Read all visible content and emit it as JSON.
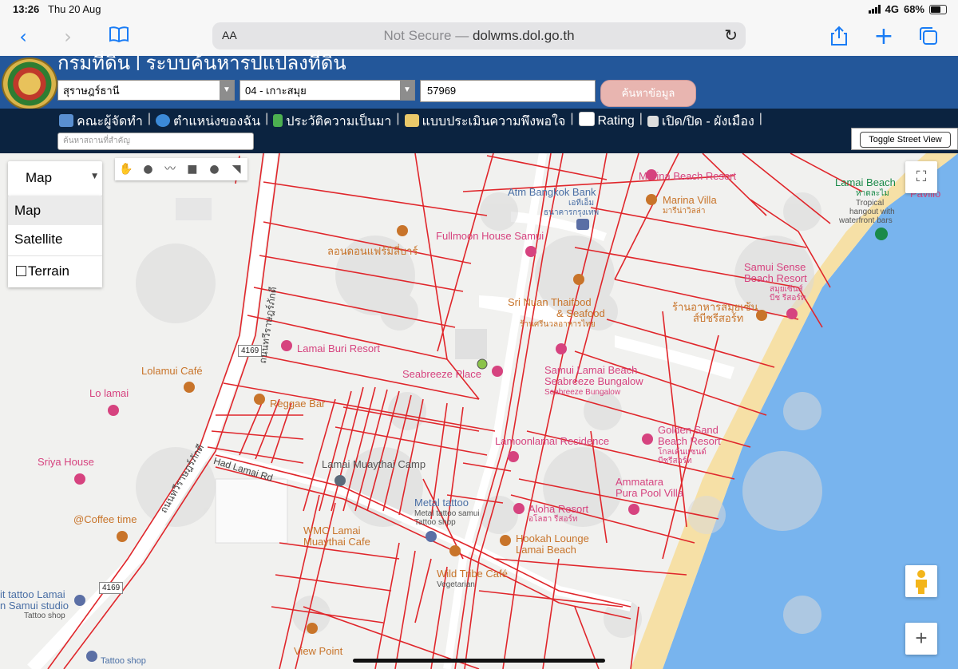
{
  "status_bar": {
    "time": "13:26",
    "date": "Thu 20 Aug",
    "network": "4G",
    "battery": "68%"
  },
  "browser": {
    "aa_label": "AA",
    "not_secure": "Not Secure —",
    "url": "dolwms.dol.go.th"
  },
  "header": {
    "title": "กรมที่ดิน | ระบบค้นหารูปแปลงที่ดิน",
    "province": "สุราษฎร์ธานี",
    "district": "04 - เกาะสมุย",
    "parcel_number": "57969",
    "search_button": "ค้นหาข้อมูล"
  },
  "nav": {
    "items": [
      "คณะผู้จัดทำ",
      "ตำแหน่งของฉัน",
      "ประวัติความเป็นมา",
      "แบบประเมินความพึงพอใจ",
      "Rating",
      "เปิด/ปิด - ผังเมือง"
    ],
    "place_placeholder": "ค้นหาสถานที่สำคัญ",
    "toggle_street_view": "Toggle Street View"
  },
  "map_controls": {
    "map_type": "Map",
    "menu": [
      "Map",
      "Satellite",
      "Terrain"
    ],
    "zoom_in": "+"
  },
  "map_labels": {
    "marina_beach": "Marina Beach Resort",
    "marina_villa": "Marina Villa",
    "marina_villa_th": "มารีน่าวิลล่า",
    "atm": "Atm Bangkok Bank",
    "atm_th1": "เอทีเอ็ม",
    "atm_th2": "ธนาคารกรุงเทพ",
    "lamai_beach": "Lamai Beach",
    "lamai_beach_th": "หาดละไม",
    "lamai_beach_desc1": "Tropical",
    "lamai_beach_desc2": "hangout with",
    "lamai_beach_desc3": "waterfront bars",
    "pavilio": "Pavilio",
    "fullmoon": "Fullmoon House Samui",
    "london": "ลอนดอนแฟร์มิลี่บาร์",
    "samui_sense1": "Samui Sense",
    "samui_sense2": "Beach Resort",
    "samui_sense_th1": "สมุยเซ้นส์",
    "samui_sense_th2": "บีช รีสอร์ท",
    "sri_nuan1": "Sri Nuan Thaifood",
    "sri_nuan2": "& Seafood",
    "sri_nuan_th": "ร้านศรีนวลอาหารไทย",
    "samui_sense_restaurant_th1": "ร้านอาหารสมุยเซ้น",
    "samui_sense_restaurant_th2": "ส์บีชรีสอร์ท",
    "road_4169_top": "4169",
    "lamai_buri": "Lamai Buri Resort",
    "seabreeze": "Seabreeze Place",
    "samui_lamai1": "Samui Lamai Beach",
    "samui_lamai2": "Seabreeze Bungalow",
    "samui_lamai3": "Seabreeze Bungalow",
    "lolamui": "Lolamui Café",
    "lo_lamai": "Lo lamai",
    "reggae": "Reggae Bar",
    "golden_sand1": "Golden Sand",
    "golden_sand2": "Beach Resort",
    "golden_sand_th1": "โกลเด้นแซนด์",
    "golden_sand_th2": "บีชรีสอร์ท",
    "lamoon": "Lamoonlamai Residence",
    "sriya": "Sriya House",
    "muaythai_camp": "Lamai Muaythai Camp",
    "had_lamai": "Had Lamai Rd",
    "ammatara1": "Ammatara",
    "ammatara2": "Pura Pool Villa",
    "metal_tattoo": "Metal tattoo",
    "metal_tattoo_sub1": "Metal tattoo samui",
    "metal_tattoo_sub2": "Tattoo shop",
    "aloha": "Aloha Resort",
    "aloha_th": "อโลฮา รีสอร์ท",
    "coffee_time": "@Coffee time",
    "wmc1": "WMC Lamai",
    "wmc2": "Muaythai Cafe",
    "hookah1": "Hookah Lounge",
    "hookah2": "Lamai Beach",
    "wild_tribe": "Wild Tribe Café",
    "wild_tribe_sub": "Vegetarian",
    "road_4169_bottom": "4169",
    "tattoo_lamai1": "it tattoo Lamai",
    "tattoo_lamai2": "n Samui studio",
    "tattoo_lamai3": "Tattoo shop",
    "tattoo_shop": "Tattoo shop",
    "view_point": "View Point",
    "road_th": "ถนนทวีราษฎร์ภักดี"
  },
  "colors": {
    "parcel_line": "#e0262b",
    "header_blue": "#23579a",
    "nav_dark": "#0b2340",
    "beach": "#f6e0a6",
    "sea": "#78b4ee",
    "poi_pink": "#d6437f",
    "poi_orange": "#c8742a"
  }
}
